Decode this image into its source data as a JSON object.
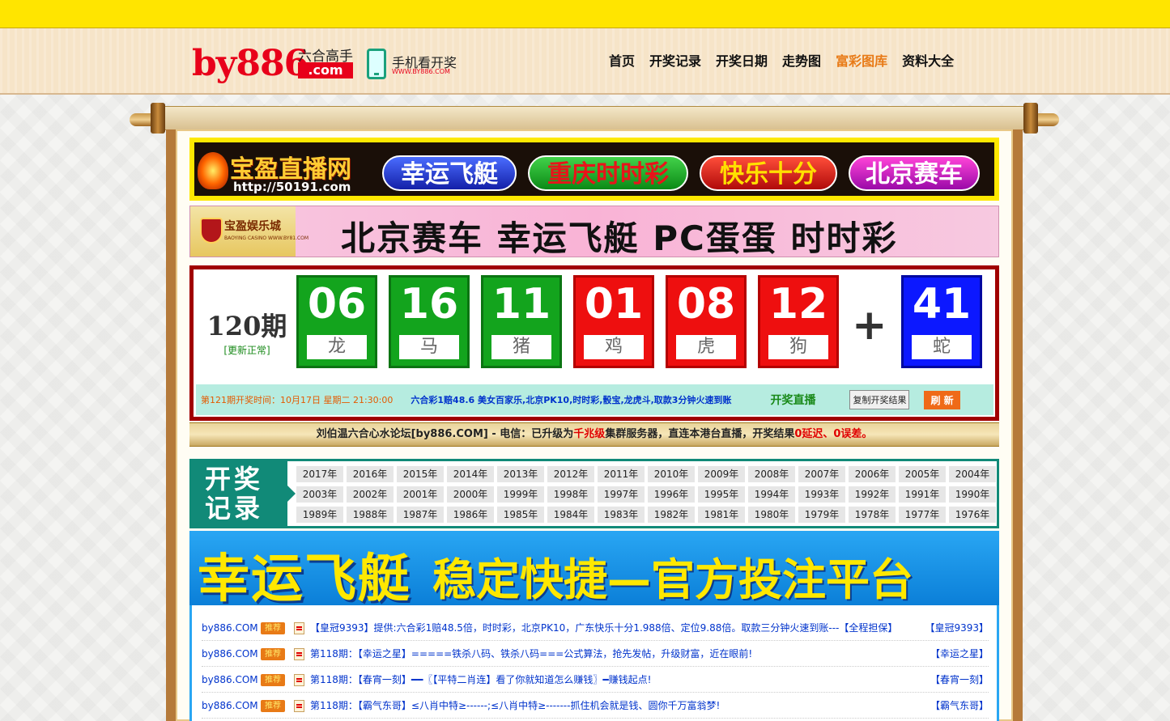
{
  "header": {
    "logo_main": "by886",
    "logo_sub": "六合高手",
    "logo_domain": ".com",
    "mobile_label": "手机看开奖",
    "mobile_url": "WWW.BY886.COM",
    "nav": [
      "首页",
      "开奖记录",
      "开奖日期",
      "走势图",
      "富彩图库",
      "资料大全"
    ],
    "active_nav": "富彩图库"
  },
  "banner1": {
    "logo_text": "宝盈直播网",
    "url": "http://50191.com",
    "pills": [
      "幸运飞艇",
      "重庆时时彩",
      "快乐十分",
      "北京赛车"
    ]
  },
  "banner2": {
    "logo_text": "宝盈娱乐城",
    "logo_sub": "BAOYING CASINO WWW.BY81.COM",
    "text": "北京赛车 幸运飞艇 PC蛋蛋 时时彩"
  },
  "draw": {
    "period": "120期",
    "status": "[更新正常]",
    "balls": [
      {
        "number": "06",
        "zodiac": "龙",
        "color": "green"
      },
      {
        "number": "16",
        "zodiac": "马",
        "color": "green"
      },
      {
        "number": "11",
        "zodiac": "猪",
        "color": "green"
      },
      {
        "number": "01",
        "zodiac": "鸡",
        "color": "red"
      },
      {
        "number": "08",
        "zodiac": "虎",
        "color": "red"
      },
      {
        "number": "12",
        "zodiac": "狗",
        "color": "red"
      }
    ],
    "plus": "+",
    "special": {
      "number": "41",
      "zodiac": "蛇",
      "color": "blue"
    },
    "next_time": "第121期开奖时间：10月17日 星期二 21:30:00",
    "promo": "六合彩1赔48.6 美女百家乐,北京PK10,时时彩,骰宝,龙虎斗,取款3分钟火速到账",
    "live_label": "开奖直播",
    "copy_button": "复制开奖结果",
    "refresh_button": "刷 新"
  },
  "notice": {
    "text_before": "刘伯温六合心水论坛[by886.COM] - 电信：已升级为",
    "highlight1": "千兆级",
    "text_middle": "集群服务器，直连本港台直播，开奖结果",
    "highlight2": "0延迟、0误差。"
  },
  "records": {
    "title": "开奖记录",
    "years": [
      "2017年",
      "2016年",
      "2015年",
      "2014年",
      "2013年",
      "2012年",
      "2011年",
      "2010年",
      "2009年",
      "2008年",
      "2007年",
      "2006年",
      "2005年",
      "2004年",
      "2003年",
      "2002年",
      "2001年",
      "2000年",
      "1999年",
      "1998年",
      "1997年",
      "1996年",
      "1995年",
      "1994年",
      "1993年",
      "1992年",
      "1991年",
      "1990年",
      "1989年",
      "1988年",
      "1987年",
      "1986年",
      "1985年",
      "1984年",
      "1983年",
      "1982年",
      "1981年",
      "1980年",
      "1979年",
      "1978年",
      "1977年",
      "1976年"
    ]
  },
  "banner3": {
    "title": "幸运飞艇",
    "subtitle": "稳定快捷—官方投注平台"
  },
  "posts": [
    {
      "site": "by886.COM",
      "tag": "推荐",
      "title": "【皇冠9393】提供:六合彩1赔48.5倍，时时彩，北京PK10，广东快乐十分1.988倍、定位9.88倍。取款三分钟火速到账---【全程担保】",
      "source": "【皇冠9393】"
    },
    {
      "site": "by886.COM",
      "tag": "推荐",
      "title": "第118期：【幸运之星】=====铁杀八码、铁杀八码===公式算法，抢先发帖，升级财富，近在眼前!",
      "source": "【幸运之星】"
    },
    {
      "site": "by886.COM",
      "tag": "推荐",
      "title": "第118期：【春宵一刻】━━〖【平特二肖连】看了你就知道怎么赚钱〗━赚钱起点!",
      "source": "【春宵一刻】"
    },
    {
      "site": "by886.COM",
      "tag": "推荐",
      "title": "第118期：【霸气东哥】≤八肖中特≥------;≤八肖中特≥-------抓住机会就是钱、圆你千万富翁梦!",
      "source": "【霸气东哥】"
    }
  ]
}
